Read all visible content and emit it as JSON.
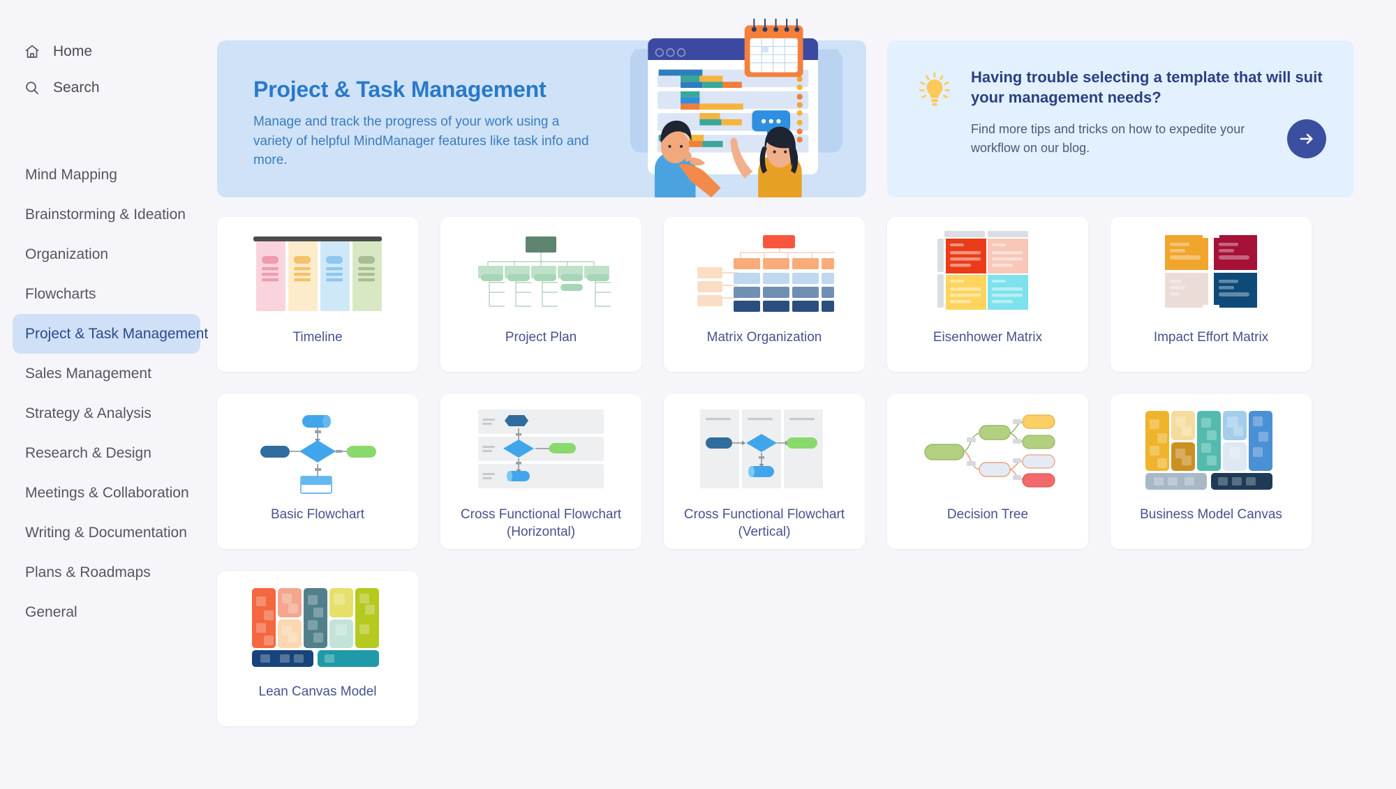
{
  "sidebar": {
    "top_items": [
      {
        "label": "Home",
        "icon": "home-icon"
      },
      {
        "label": "Search",
        "icon": "search-icon"
      }
    ],
    "categories": [
      {
        "label": "Mind Mapping",
        "active": false
      },
      {
        "label": "Brainstorming & Ideation",
        "active": false
      },
      {
        "label": "Organization",
        "active": false
      },
      {
        "label": "Flowcharts",
        "active": false
      },
      {
        "label": "Project & Task Management",
        "active": true
      },
      {
        "label": "Sales Management",
        "active": false
      },
      {
        "label": "Strategy & Analysis",
        "active": false
      },
      {
        "label": "Research & Design",
        "active": false
      },
      {
        "label": "Meetings & Collaboration",
        "active": false
      },
      {
        "label": "Writing & Documentation",
        "active": false
      },
      {
        "label": "Plans & Roadmaps",
        "active": false
      },
      {
        "label": "General",
        "active": false
      }
    ],
    "active_category": "Project & Task Management",
    "active_bg": "#cfe0f7",
    "active_text": "#2c4a8a"
  },
  "hero": {
    "title": "Project & Task Management",
    "subtitle": "Manage and track the progress of your work using a variety of helpful MindManager features like task info and more.",
    "bg": "#cfe2f7",
    "title_color": "#2a79c9",
    "illustration": "project-board-illustration"
  },
  "tip_card": {
    "icon": "lightbulb-icon",
    "title": "Having trouble selecting a template that will suit your management needs?",
    "body": "Find more tips and tricks on how to expedite your workflow on our blog.",
    "arrow_icon": "arrow-right-icon",
    "bg": "#e3f0fd",
    "title_color": "#2c3f82",
    "arrow_bg": "#3a4fa0"
  },
  "templates": [
    {
      "label": "Timeline",
      "thumb": "timeline-thumb"
    },
    {
      "label": "Project Plan",
      "thumb": "project-plan-thumb"
    },
    {
      "label": "Matrix Organization",
      "thumb": "matrix-organization-thumb"
    },
    {
      "label": "Eisenhower Matrix",
      "thumb": "eisenhower-matrix-thumb"
    },
    {
      "label": "Impact Effort Matrix",
      "thumb": "impact-effort-matrix-thumb"
    },
    {
      "label": "Basic Flowchart",
      "thumb": "basic-flowchart-thumb"
    },
    {
      "label": "Cross Functional Flowchart (Horizontal)",
      "thumb": "cross-functional-horizontal-thumb"
    },
    {
      "label": "Cross Functional Flowchart (Vertical)",
      "thumb": "cross-functional-vertical-thumb"
    },
    {
      "label": "Decision Tree",
      "thumb": "decision-tree-thumb"
    },
    {
      "label": "Business Model Canvas",
      "thumb": "business-model-canvas-thumb"
    },
    {
      "label": "Lean Canvas Model",
      "thumb": "lean-canvas-model-thumb"
    }
  ],
  "palette": {
    "page_bg": "#f6f6fa",
    "card_bg": "#ffffff",
    "label_color": "#46528f"
  }
}
